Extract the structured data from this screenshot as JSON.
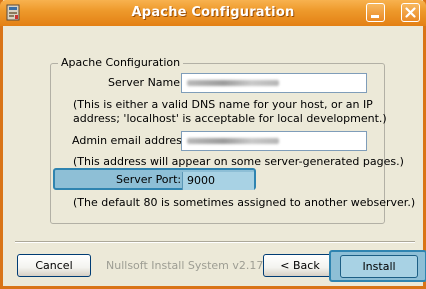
{
  "window": {
    "title": "Apache Configuration",
    "minimize_icon": "minimize-icon",
    "close_icon": "close-icon",
    "app_icon": "installer-app-icon"
  },
  "group": {
    "legend": "Apache Configuration"
  },
  "server_name": {
    "label": "Server Name:",
    "value_redacted": true,
    "note_line1": "(This is either a valid DNS name for your host, or an IP",
    "note_line2": "address; 'localhost' is acceptable for local development.)"
  },
  "admin_email": {
    "label": "Admin email address:",
    "value_redacted": true,
    "note": "(This address will appear on some server-generated pages.)"
  },
  "server_port": {
    "label": "Server Port:",
    "value": "9000",
    "note": "(The default 80 is sometimes assigned to another webserver.)"
  },
  "footer": {
    "brand": "Nullsoft Install System v2.17",
    "cancel_label": "Cancel",
    "back_label": "< Back",
    "install_label": "Install"
  },
  "colors": {
    "titlebar": "#ee9a2c",
    "highlight": "#8ebfd6",
    "highlight_border": "#2f84b0"
  }
}
